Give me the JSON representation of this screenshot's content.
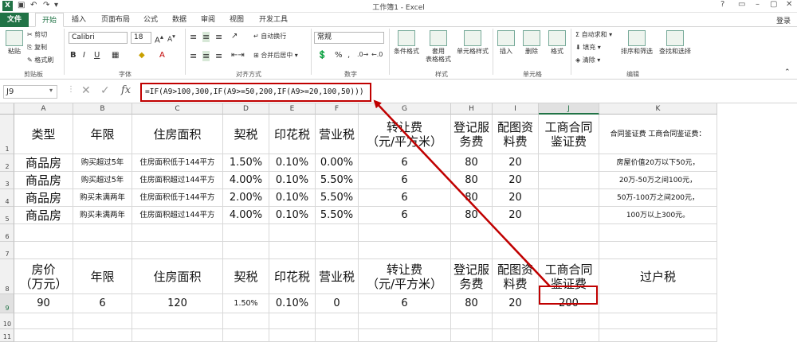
{
  "window": {
    "title": "工作簿1 - Excel",
    "help": "?",
    "login": "登录"
  },
  "tabs": [
    "文件",
    "开始",
    "插入",
    "页面布局",
    "公式",
    "数据",
    "审阅",
    "视图",
    "开发工具"
  ],
  "ribbon": {
    "clipboard": {
      "label": "剪贴板",
      "paste": "粘贴",
      "cut": "剪切",
      "copy": "复制",
      "painter": "格式刷"
    },
    "font": {
      "label": "字体",
      "name": "Calibri",
      "size": "18",
      "bold": "B",
      "italic": "I",
      "underline": "U"
    },
    "align": {
      "label": "对齐方式",
      "wrap": "自动换行",
      "merge": "合并后居中"
    },
    "number": {
      "label": "数字",
      "format": "常规",
      "pct": "%",
      "comma": ","
    },
    "styles": {
      "label": "样式",
      "cond": "条件格式",
      "table": "套用\n表格格式",
      "cell": "单元格样式"
    },
    "cells": {
      "label": "单元格",
      "insert": "插入",
      "delete": "删除",
      "format": "格式"
    },
    "editing": {
      "label": "编辑",
      "autosum": "自动求和",
      "fill": "填充",
      "clear": "清除",
      "sort": "排序和筛选",
      "find": "查找和选择"
    }
  },
  "formula_bar": {
    "name_box": "J9",
    "fx": "fx",
    "formula": "=IF(A9>100,300,IF(A9>=50,200,IF(A9>=20,100,50)))"
  },
  "columns": [
    "A",
    "B",
    "C",
    "D",
    "E",
    "F",
    "G",
    "H",
    "I",
    "J",
    "K"
  ],
  "rows": [
    "1",
    "2",
    "3",
    "4",
    "5",
    "6",
    "7",
    "8",
    "9",
    "10",
    "11"
  ],
  "cells": {
    "r1": [
      "类型",
      "年限",
      "住房面积",
      "契税",
      "印花税",
      "营业税",
      "转让费\n（元/平方米）",
      "登记服\n务费",
      "配图资\n料费",
      "工商合同\n鉴证费",
      "合同鉴证费 工商合同鉴证费："
    ],
    "r2": [
      "商品房",
      "购买超过5年",
      "住房面积低于144平方",
      "1.50%",
      "0.10%",
      "0.00%",
      "6",
      "80",
      "20",
      "",
      "房屋价值20万以下50元，"
    ],
    "r3": [
      "商品房",
      "购买超过5年",
      "住房面积超过144平方",
      "4.00%",
      "0.10%",
      "5.50%",
      "6",
      "80",
      "20",
      "",
      "20万-50万之间100元，"
    ],
    "r4": [
      "商品房",
      "购买未满两年",
      "住房面积低于144平方",
      "2.00%",
      "0.10%",
      "5.50%",
      "6",
      "80",
      "20",
      "",
      "50万-100万之间200元，"
    ],
    "r5": [
      "商品房",
      "购买未满两年",
      "住房面积超过144平方",
      "4.00%",
      "0.10%",
      "5.50%",
      "6",
      "80",
      "20",
      "",
      "100万以上300元。"
    ],
    "r8": [
      "房价\n（万元）",
      "年限",
      "住房面积",
      "契税",
      "印花税",
      "营业税",
      "转让费\n（元/平方米）",
      "登记服\n务费",
      "配图资\n料费",
      "工商合同\n鉴证费",
      "过户税"
    ],
    "r9": [
      "90",
      "6",
      "120",
      "1.50%",
      "0.10%",
      "0",
      "6",
      "80",
      "20",
      "200",
      ""
    ]
  }
}
